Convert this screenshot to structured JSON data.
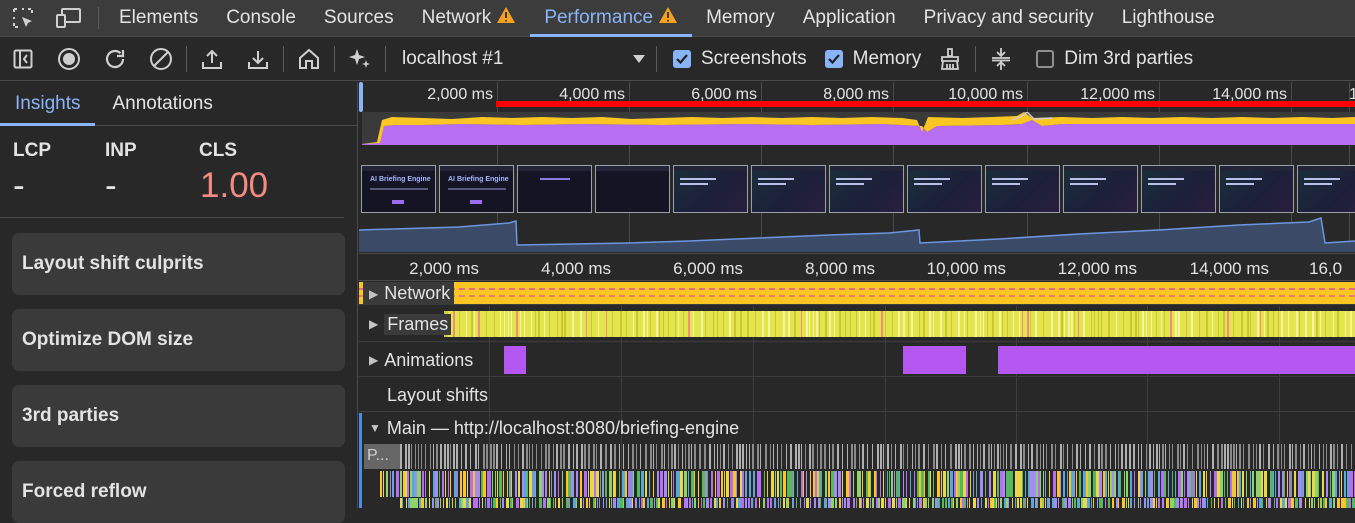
{
  "tabs": [
    {
      "label": "Elements",
      "active": false,
      "warning": false
    },
    {
      "label": "Console",
      "active": false,
      "warning": false
    },
    {
      "label": "Sources",
      "active": false,
      "warning": false
    },
    {
      "label": "Network",
      "active": false,
      "warning": true
    },
    {
      "label": "Performance",
      "active": true,
      "warning": true
    },
    {
      "label": "Memory",
      "active": false,
      "warning": false
    },
    {
      "label": "Application",
      "active": false,
      "warning": false
    },
    {
      "label": "Privacy and security",
      "active": false,
      "warning": false
    },
    {
      "label": "Lighthouse",
      "active": false,
      "warning": false
    }
  ],
  "toolbar": {
    "target": "localhost #1",
    "screenshots_label": "Screenshots",
    "screenshots_checked": true,
    "memory_label": "Memory",
    "memory_checked": true,
    "dim_label": "Dim 3rd parties",
    "dim_checked": false
  },
  "sidebar": {
    "tabs": [
      "Insights",
      "Annotations"
    ],
    "metrics": [
      {
        "label": "LCP",
        "value": "-"
      },
      {
        "label": "INP",
        "value": "-"
      },
      {
        "label": "CLS",
        "value": "1.00"
      }
    ],
    "insights": [
      "Layout shift culprits",
      "Optimize DOM size",
      "3rd parties",
      "Forced reflow"
    ]
  },
  "overview_ticks": [
    "2,000 ms",
    "4,000 ms",
    "6,000 ms",
    "8,000 ms",
    "10,000 ms",
    "12,000 ms",
    "14,000 ms",
    "1"
  ],
  "ruler_ticks": [
    "2,000 ms",
    "4,000 ms",
    "6,000 ms",
    "8,000 ms",
    "10,000 ms",
    "12,000 ms",
    "14,000 ms",
    "16,0"
  ],
  "screenshots": [
    {
      "title": "AI Briefing Engine"
    },
    {
      "title": "AI Briefing Engine"
    },
    {
      "title": ""
    },
    {
      "title": ""
    },
    {
      "title": ""
    },
    {
      "title": ""
    },
    {
      "title": ""
    },
    {
      "title": ""
    },
    {
      "title": ""
    },
    {
      "title": ""
    },
    {
      "title": ""
    },
    {
      "title": ""
    },
    {
      "title": ""
    }
  ],
  "tracks": {
    "network": "Network",
    "frames": "Frames",
    "animations": "Animations",
    "layout_shifts": "Layout shifts",
    "main": "Main — http://localhost:8080/briefing-engine",
    "task_label": "P..."
  },
  "colors": {
    "accent": "#8ab4f8",
    "cls_bad": "#f28b82",
    "cpu_scripting": "#f9c623",
    "cpu_rendering": "#b76ef2",
    "cpu_painting": "#56b85a",
    "long_task": "#ff0000",
    "animation": "#b457f0",
    "frames": "#e4e44c",
    "warning": "#f4a020"
  }
}
